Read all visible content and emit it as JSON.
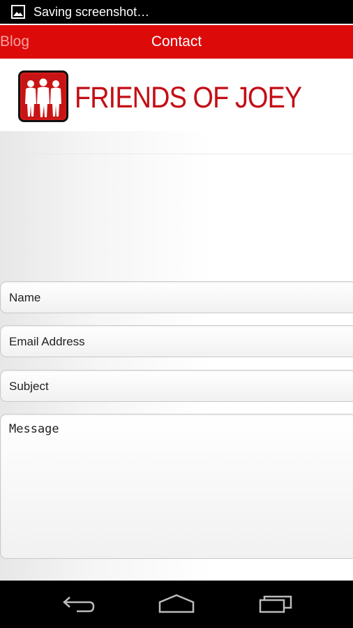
{
  "status_bar": {
    "icon": "image-icon",
    "text": "Saving screenshot…"
  },
  "nav": {
    "back_label": "Blog",
    "title": "Contact",
    "bar_color": "#dd0a0a"
  },
  "logo": {
    "text": "FRIENDS OF JOEY",
    "color": "#c40d15"
  },
  "form": {
    "name_placeholder": "Name",
    "email_placeholder": "Email Address",
    "subject_placeholder": "Subject",
    "message_placeholder": "Message"
  },
  "system_nav": {
    "back": "back-icon",
    "home": "home-icon",
    "recents": "recents-icon"
  }
}
